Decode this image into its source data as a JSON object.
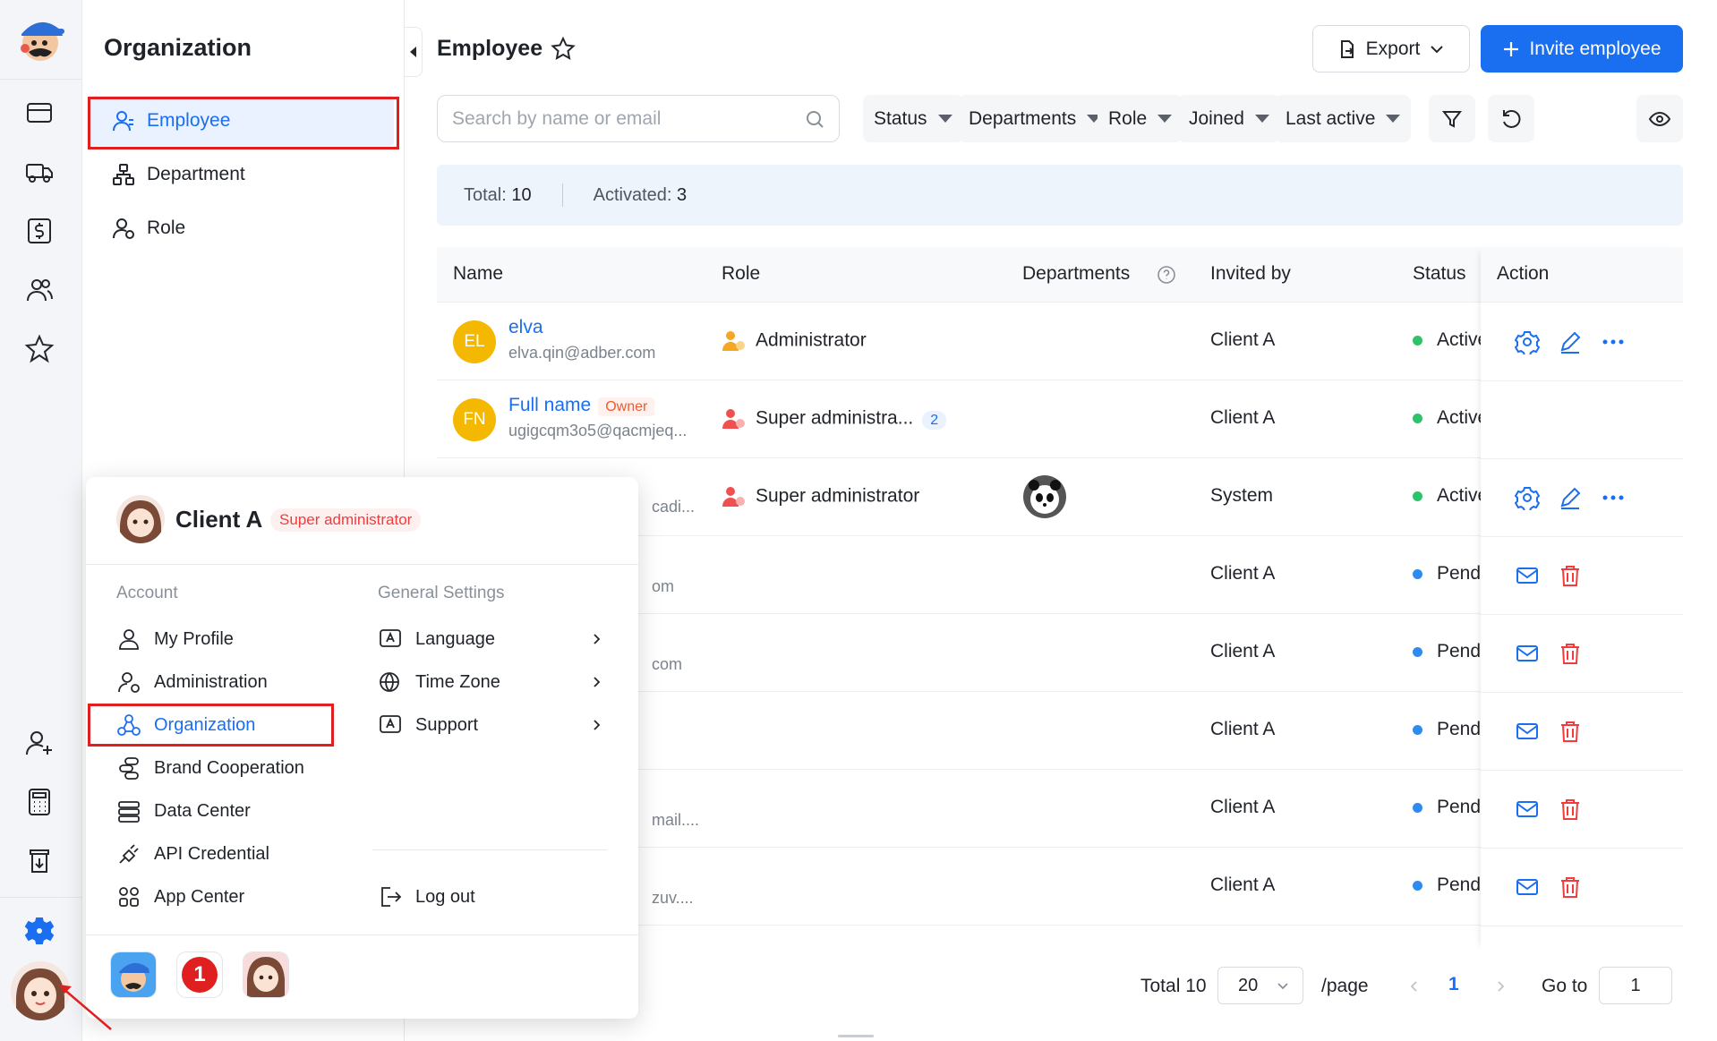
{
  "subnav": {
    "title": "Organization",
    "items": [
      {
        "label": "Employee",
        "icon": "user-icon",
        "active": true
      },
      {
        "label": "Department",
        "icon": "hierarchy-icon",
        "active": false
      },
      {
        "label": "Role",
        "icon": "user-gear-icon",
        "active": false
      }
    ]
  },
  "rail": {
    "icons": [
      "wallet-icon",
      "truck-icon",
      "dollar-icon",
      "users-icon",
      "star-icon",
      "add-user-icon",
      "calculator-icon",
      "download-icon",
      "settings-icon"
    ]
  },
  "header": {
    "title": "Employee",
    "export_label": "Export",
    "invite_label": "Invite employee"
  },
  "search": {
    "placeholder": "Search by name or email"
  },
  "filters": [
    "Status",
    "Departments",
    "Role",
    "Joined",
    "Last active"
  ],
  "summary": {
    "total_label": "Total:",
    "total": "10",
    "activated_label": "Activated:",
    "activated": "3"
  },
  "table": {
    "columns": [
      "Name",
      "Role",
      "Departments",
      "Invited by",
      "Status",
      "Action"
    ],
    "rows": [
      {
        "initials": "EL",
        "name": "elva",
        "email": "elva.qin@adber.com",
        "role": "Administrator",
        "invited_by": "Client A",
        "status": "Active"
      },
      {
        "initials": "FN",
        "name": "Full name",
        "owner": "Owner",
        "email": "ugigcqm3o5@qacmjeq...",
        "role": "Super administra...",
        "role_count": "2",
        "invited_by": "Client A",
        "status": "Active"
      },
      {
        "email": "cadi...",
        "role": "Super administrator",
        "invited_by": "System",
        "status": "Active"
      },
      {
        "email": "om",
        "invited_by": "Client A",
        "status": "Pendi"
      },
      {
        "email": "com",
        "invited_by": "Client A",
        "status": "Pendi"
      },
      {
        "email": "",
        "invited_by": "Client A",
        "status": "Pendi"
      },
      {
        "email": "mail....",
        "invited_by": "Client A",
        "status": "Pendi"
      },
      {
        "email": "zuv....",
        "invited_by": "Client A",
        "status": "Pendi"
      }
    ]
  },
  "pagination": {
    "total_label": "Total 10",
    "page_size": "20",
    "per_page": "/page",
    "current": "1",
    "goto_label": "Go to",
    "goto_value": "1"
  },
  "popover": {
    "name": "Client A",
    "role": "Super administrator",
    "account_label": "Account",
    "general_label": "General Settings",
    "account_items": [
      "My Profile",
      "Administration",
      "Organization",
      "Brand Cooperation",
      "Data Center",
      "API Credential",
      "App Center"
    ],
    "general_items": [
      "Language",
      "Time Zone",
      "Support"
    ],
    "logout": "Log out",
    "badge": "1"
  },
  "colors": {
    "primary": "#1a6ef0",
    "active_status": "#2fc26b",
    "pending_status": "#2e8cf0",
    "danger": "#f03c3c",
    "highlight_box": "#e02020"
  }
}
